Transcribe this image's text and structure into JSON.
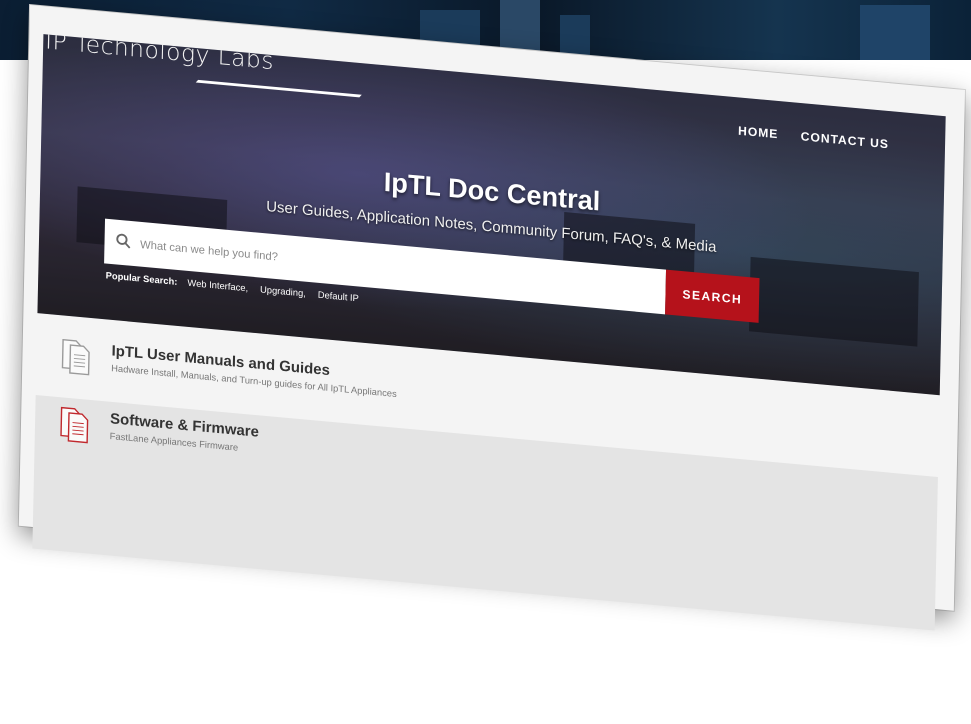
{
  "brand": {
    "logo_text": "IP Technology Labs"
  },
  "nav": {
    "items": [
      "HOME",
      "CONTACT US"
    ]
  },
  "hero": {
    "title": "IpTL Doc Central",
    "subtitle": "User Guides, Application Notes, Community Forum, FAQ's, & Media"
  },
  "search": {
    "placeholder": "What can we help you find?",
    "button_label": "SEARCH",
    "popular_label": "Popular Search:",
    "popular_links": [
      "Web Interface,",
      "Upgrading,",
      "Default IP"
    ]
  },
  "categories": [
    {
      "title": "IpTL User Manuals and Guides",
      "description": "Hadware Install, Manuals, and Turn-up guides for All IpTL Appliances",
      "icon": "document-icon",
      "icon_color": "#9a9a9a"
    },
    {
      "title": "Software & Firmware",
      "description": "FastLane Appliances Firmware",
      "icon": "document-icon",
      "icon_color": "#c0282d"
    }
  ],
  "colors": {
    "accent": "#b5121b",
    "backdrop": "#0b1e33",
    "card": "#f4f4f4"
  }
}
